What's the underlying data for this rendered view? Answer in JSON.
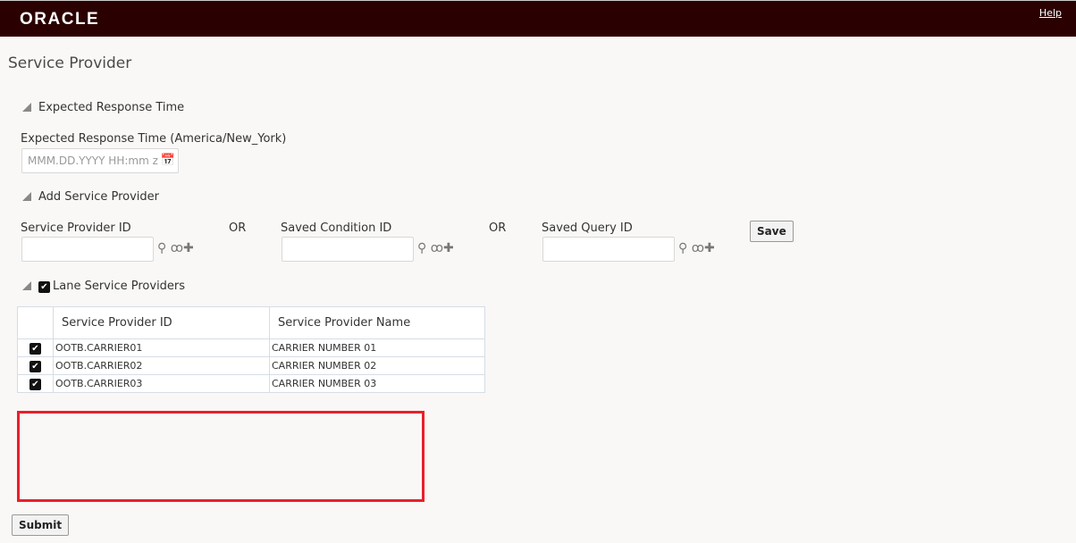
{
  "header": {
    "logo": "ORACLE",
    "help": "Help"
  },
  "page_title": "Service Provider",
  "expected": {
    "section": "Expected Response Time",
    "label": "Expected Response Time (America/New_York)",
    "placeholder": "MMM.DD.YYYY HH:mm z"
  },
  "add": {
    "section": "Add Service Provider",
    "sp_label": "Service Provider ID",
    "or": "OR",
    "cond_label": "Saved Condition ID",
    "query_label": "Saved Query ID",
    "save": "Save"
  },
  "lane": {
    "section": "Lane Service Providers",
    "columns": [
      "Service Provider ID",
      "Service Provider Name"
    ],
    "rows": [
      {
        "id": "OOTB.CARRIER01",
        "name": "CARRIER NUMBER 01"
      },
      {
        "id": "OOTB.CARRIER02",
        "name": "CARRIER NUMBER 02"
      },
      {
        "id": "OOTB.CARRIER03",
        "name": "CARRIER NUMBER 03"
      }
    ]
  },
  "submit": "Submit",
  "colors": {
    "header_bg": "#2a0000",
    "highlight_border": "#e8202a"
  }
}
